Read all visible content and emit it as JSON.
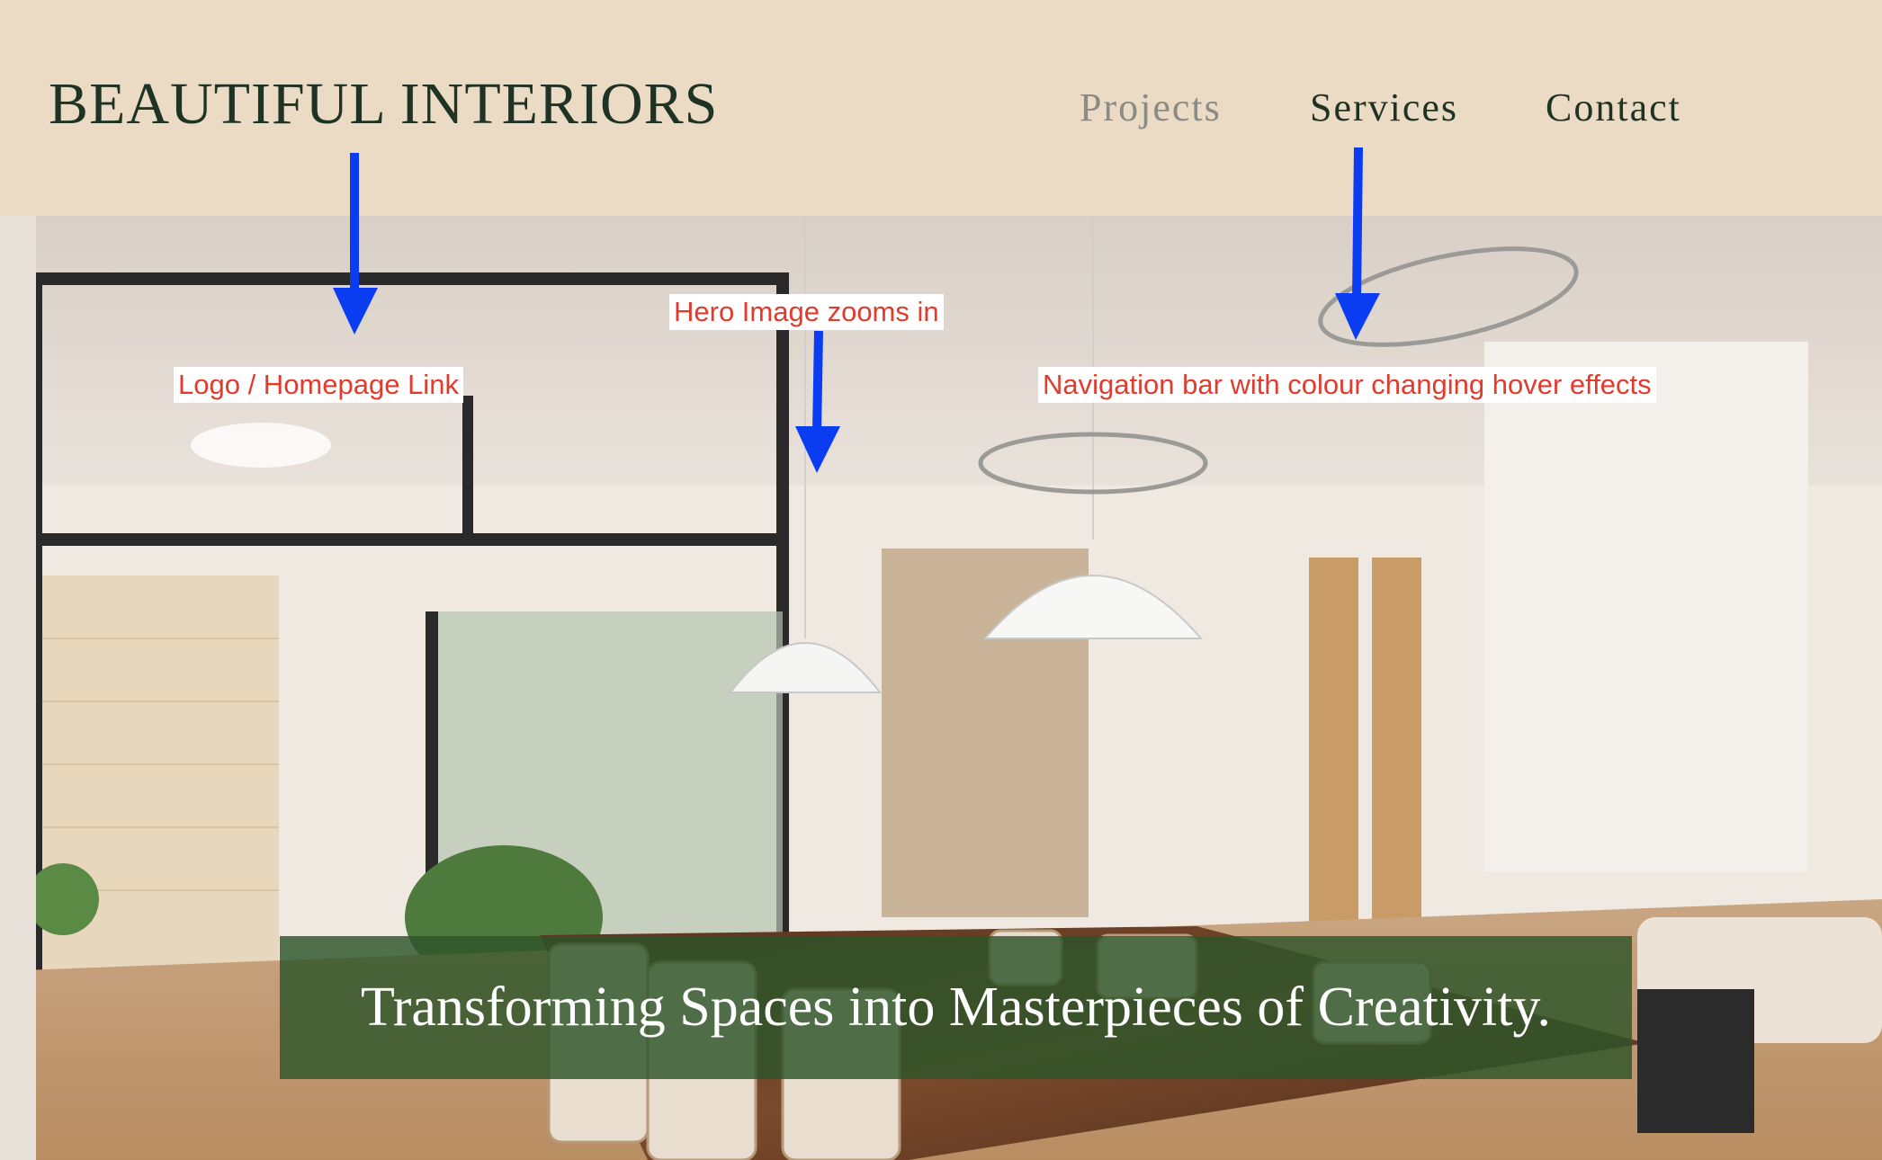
{
  "header": {
    "logo": "BEAUTIFUL INTERIORS",
    "nav": {
      "projects": "Projects",
      "services": "Services",
      "contact": "Contact"
    }
  },
  "hero": {
    "tagline": "Transforming Spaces into Masterpieces of Creativity."
  },
  "annotations": {
    "logo": "Logo / Homepage Link",
    "hero": "Hero Image zooms in",
    "nav": "Navigation bar with colour changing hover effects"
  },
  "colors": {
    "header_bg": "#ebdbc5",
    "logo_text": "#1f3324",
    "nav_active": "#8a8a86",
    "tagline_overlay": "#2d542a",
    "annotation_text": "#e23b2e",
    "annotation_arrow": "#0a3cf2"
  }
}
